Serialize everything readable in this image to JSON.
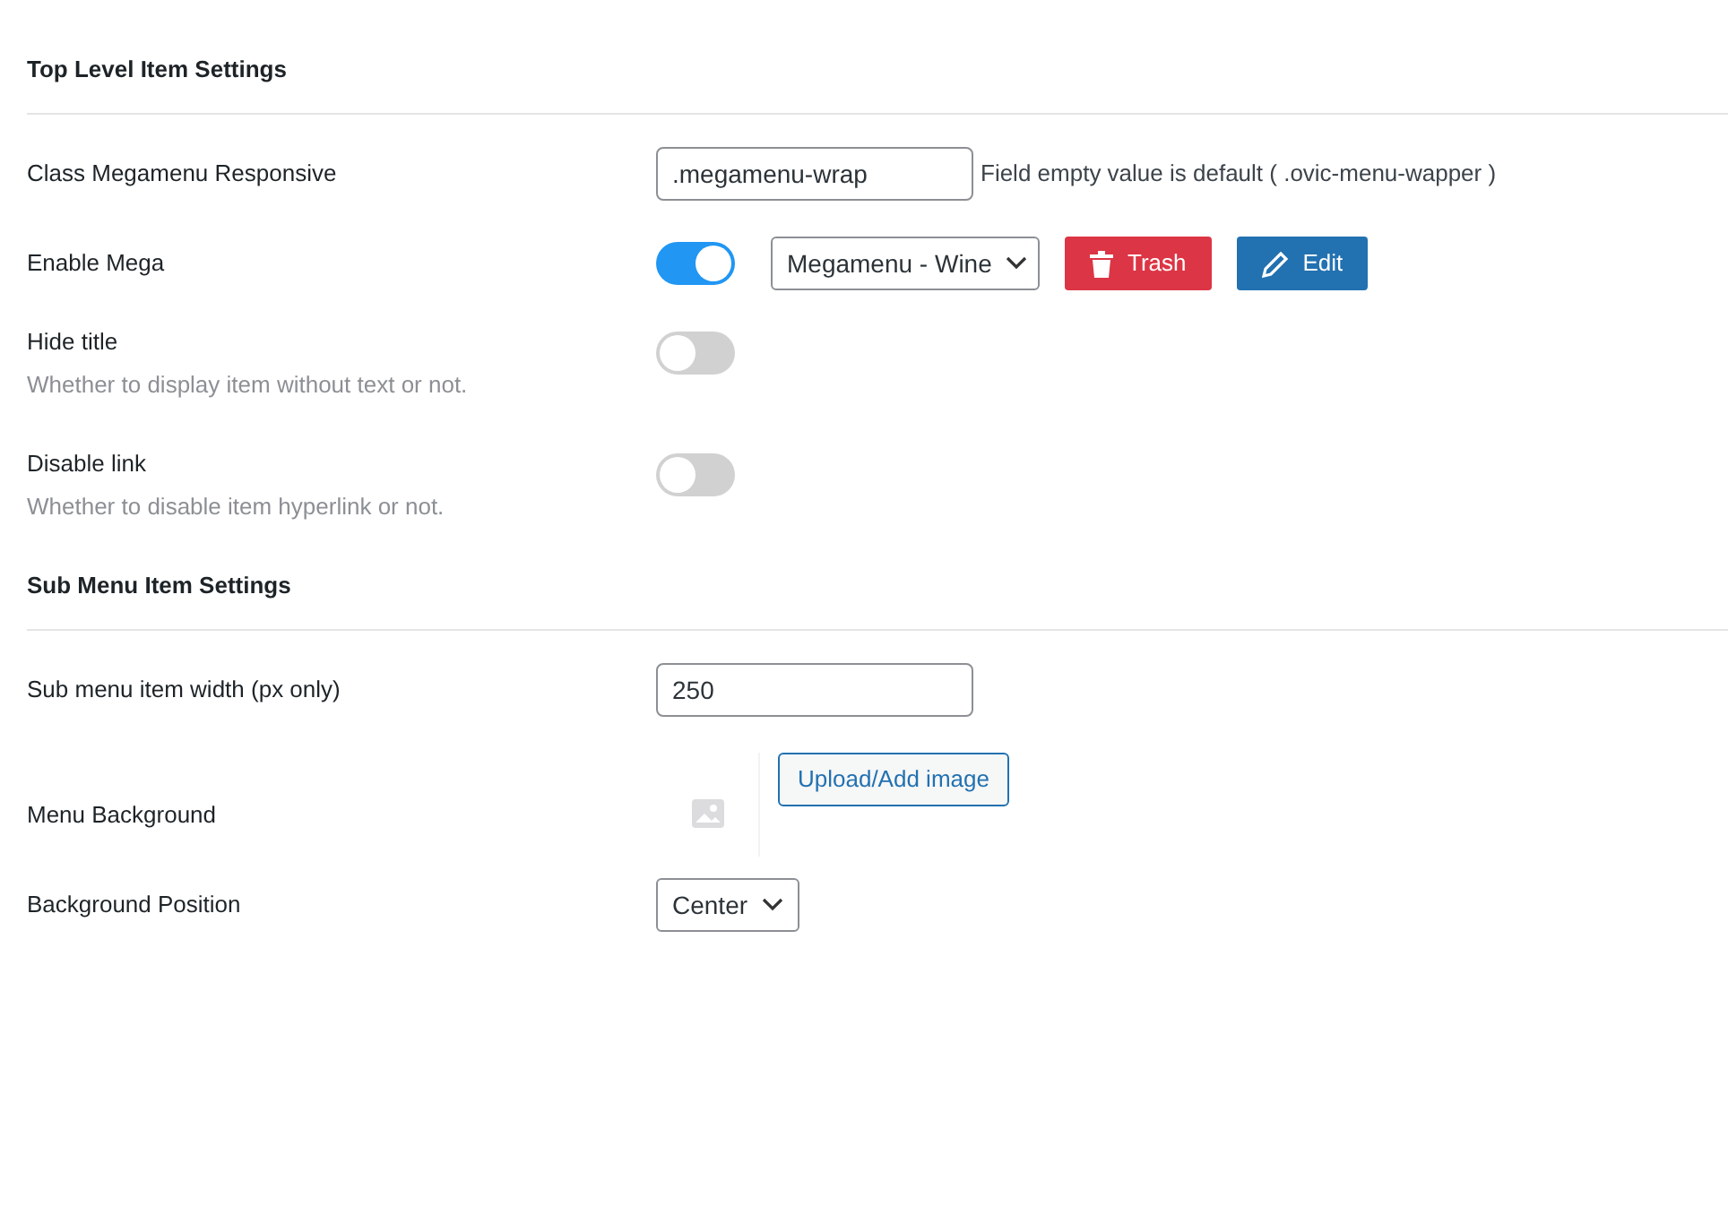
{
  "sections": [
    {
      "title": "Top Level Item Settings",
      "rows": [
        {
          "kind": "text",
          "label": "Class Megamenu Responsive",
          "value": ".megamenu-wrap",
          "help": "Field empty value is default ( .ovic-menu-wapper )"
        },
        {
          "kind": "toggle",
          "label": "Enable Mega",
          "on": true,
          "select": "Megamenu - Wine",
          "buttons": [
            {
              "kind": "trash",
              "label": "Trash"
            },
            {
              "kind": "edit",
              "label": "Edit"
            }
          ]
        },
        {
          "kind": "toggle",
          "label": "Hide title",
          "description": "Whether to display item without text or not.",
          "on": false
        },
        {
          "kind": "toggle",
          "label": "Disable link",
          "description": "Whether to disable item hyperlink or not.",
          "on": false
        }
      ]
    },
    {
      "title": "Sub Menu Item Settings",
      "rows": [
        {
          "kind": "text",
          "label": "Sub menu item width (px only)",
          "value": "250"
        },
        {
          "kind": "image",
          "label": "Menu Background",
          "button": "Upload/Add image"
        },
        {
          "kind": "select",
          "label": "Background Position",
          "select": "Center"
        }
      ]
    }
  ]
}
